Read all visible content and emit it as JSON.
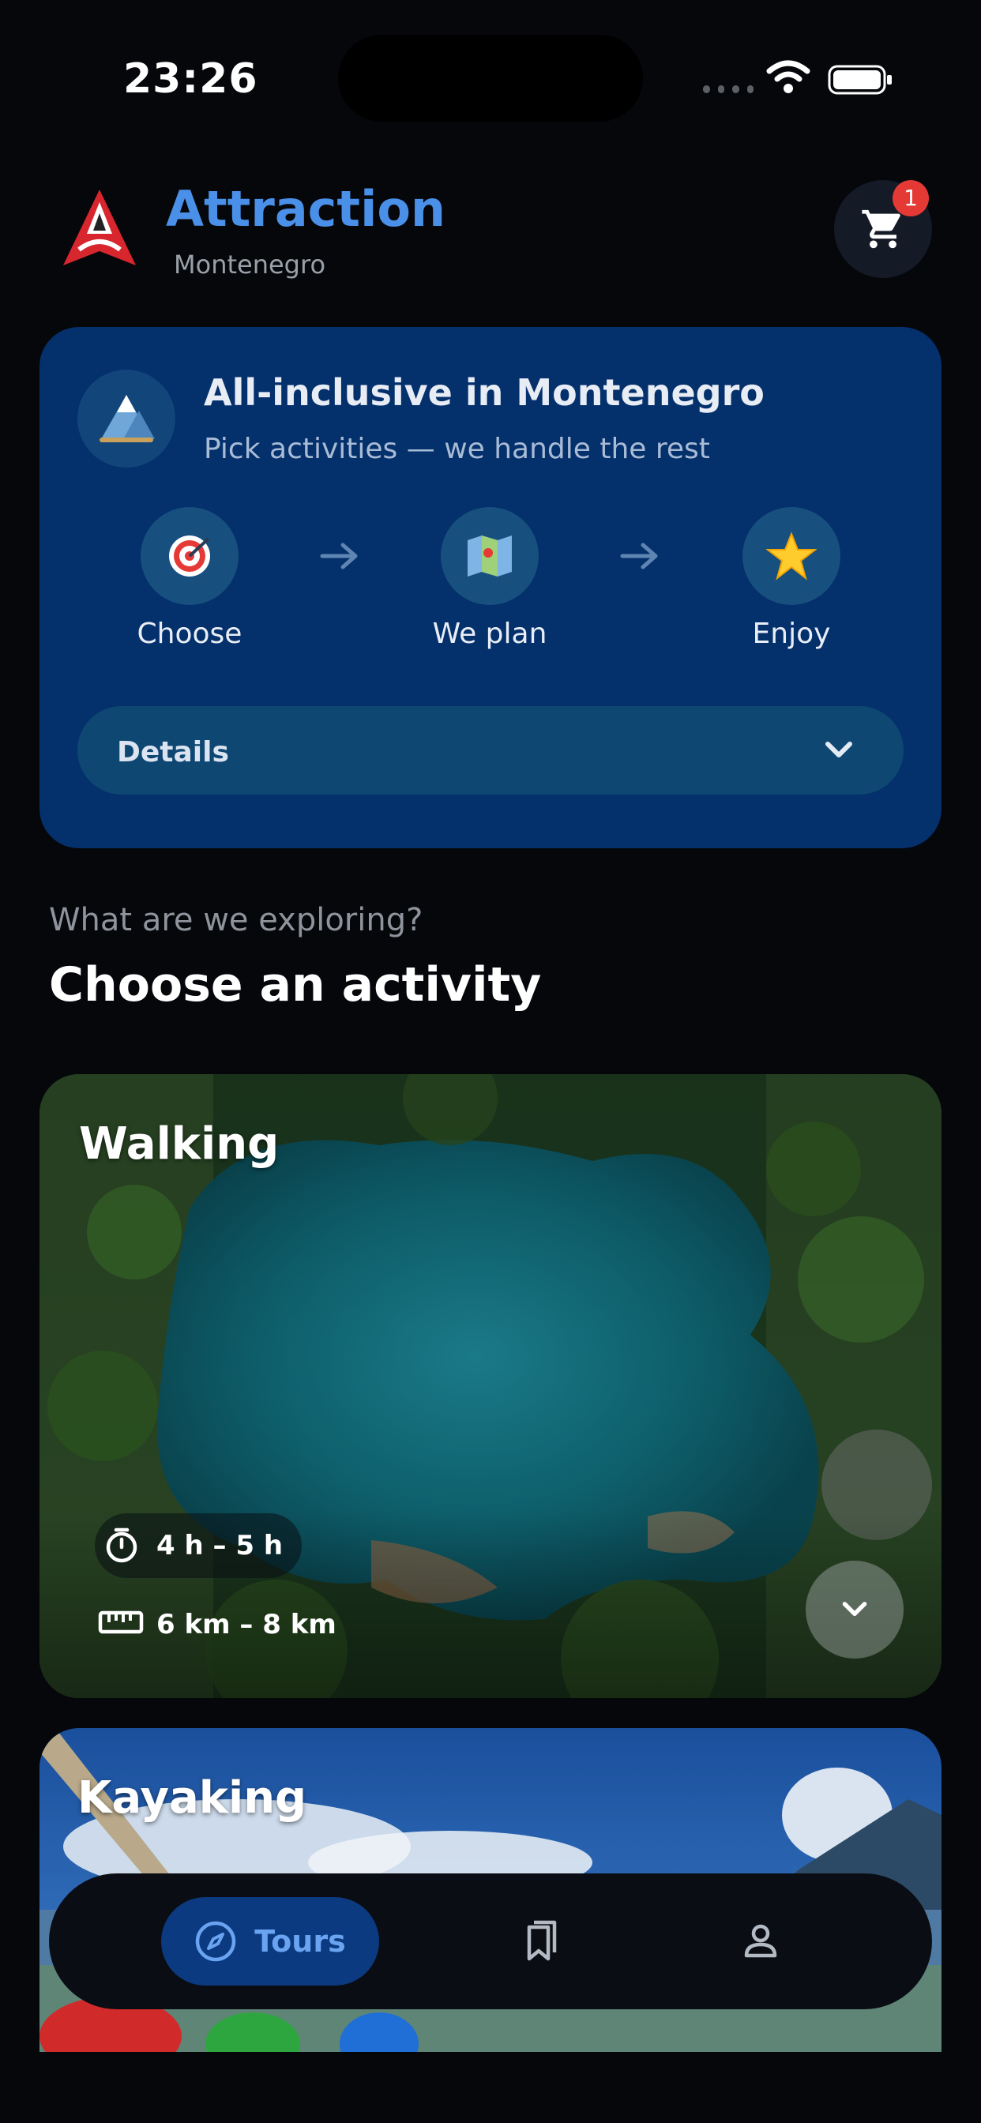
{
  "status_bar": {
    "time": "23:26"
  },
  "header": {
    "title": "Attraction",
    "subtitle": "Montenegro",
    "cart_count": "1"
  },
  "info_card": {
    "title": "All-inclusive in Montenegro",
    "subtitle": "Pick activities — we handle the rest",
    "steps": [
      {
        "icon": "target-icon",
        "label": "Choose"
      },
      {
        "icon": "map-icon",
        "label": "We plan"
      },
      {
        "icon": "star-icon",
        "label": "Enjoy"
      }
    ],
    "details_label": "Details"
  },
  "section": {
    "subtitle": "What are we exploring?",
    "title": "Choose an activity"
  },
  "activities": [
    {
      "title": "Walking",
      "duration": "4 h – 5 h",
      "distance": "6 km – 8 km"
    },
    {
      "title": "Kayaking"
    }
  ],
  "bottom_nav": {
    "tours_label": "Tours"
  },
  "colors": {
    "accent": "#4a90e8",
    "card_bg": "#04306c",
    "badge": "#e53935"
  }
}
